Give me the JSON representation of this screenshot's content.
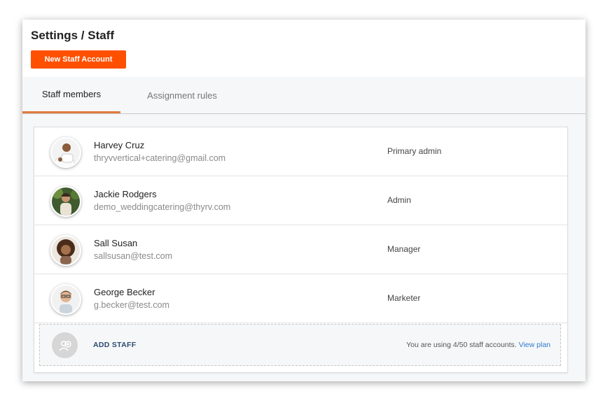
{
  "header": {
    "title": "Settings / Staff",
    "new_button_label": "New Staff Account"
  },
  "tabs": [
    {
      "label": "Staff members",
      "active": true
    },
    {
      "label": "Assignment rules",
      "active": false
    }
  ],
  "staff": [
    {
      "name": "Harvey Cruz",
      "email": "thryvvertical+catering@gmail.com",
      "role": "Primary admin"
    },
    {
      "name": "Jackie Rodgers",
      "email": "demo_weddingcatering@thyrv.com",
      "role": "Admin"
    },
    {
      "name": "Sall Susan",
      "email": "sallsusan@test.com",
      "role": "Manager"
    },
    {
      "name": "George Becker",
      "email": "g.becker@test.com",
      "role": "Marketer"
    }
  ],
  "add_staff": {
    "label": "ADD STAFF",
    "usage_text": "You are using 4/50 staff accounts.",
    "link_text": "View plan"
  },
  "colors": {
    "accent": "#ff5000",
    "tab_underline": "#e07a3f",
    "link": "#2f7bd0"
  }
}
